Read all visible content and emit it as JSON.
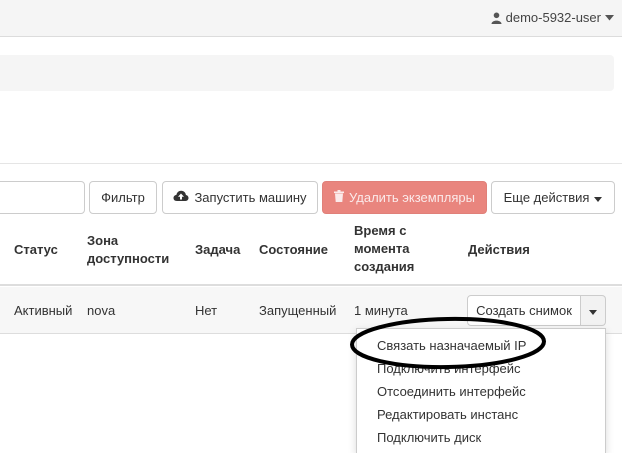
{
  "topbar": {
    "user": "demo-5932-user"
  },
  "toolbar": {
    "filter_label": "Фильтр",
    "launch_label": "Запустить машину",
    "delete_label": "Удалить экземпляры",
    "more_label": "Еще действия"
  },
  "table": {
    "headers": {
      "status": "Статус",
      "zone_l1": "Зона",
      "zone_l2": "доступности",
      "task": "Задача",
      "state": "Состояние",
      "time_l1": "Время с",
      "time_l2": "момента",
      "time_l3": "создания",
      "actions": "Действия"
    },
    "row": {
      "status": "Активный",
      "zone": "nova",
      "task": "Нет",
      "state": "Запущенный",
      "time": "1 минута",
      "action_button": "Создать снимок"
    }
  },
  "dropdown": {
    "items": [
      "Связать назначаемый IP",
      "Подключить интерфейс",
      "Отсоединить интерфейс",
      "Редактировать инстанс",
      "Подключить диск"
    ]
  },
  "colors": {
    "danger_button": "#e9857e",
    "annotation": "#000000"
  }
}
